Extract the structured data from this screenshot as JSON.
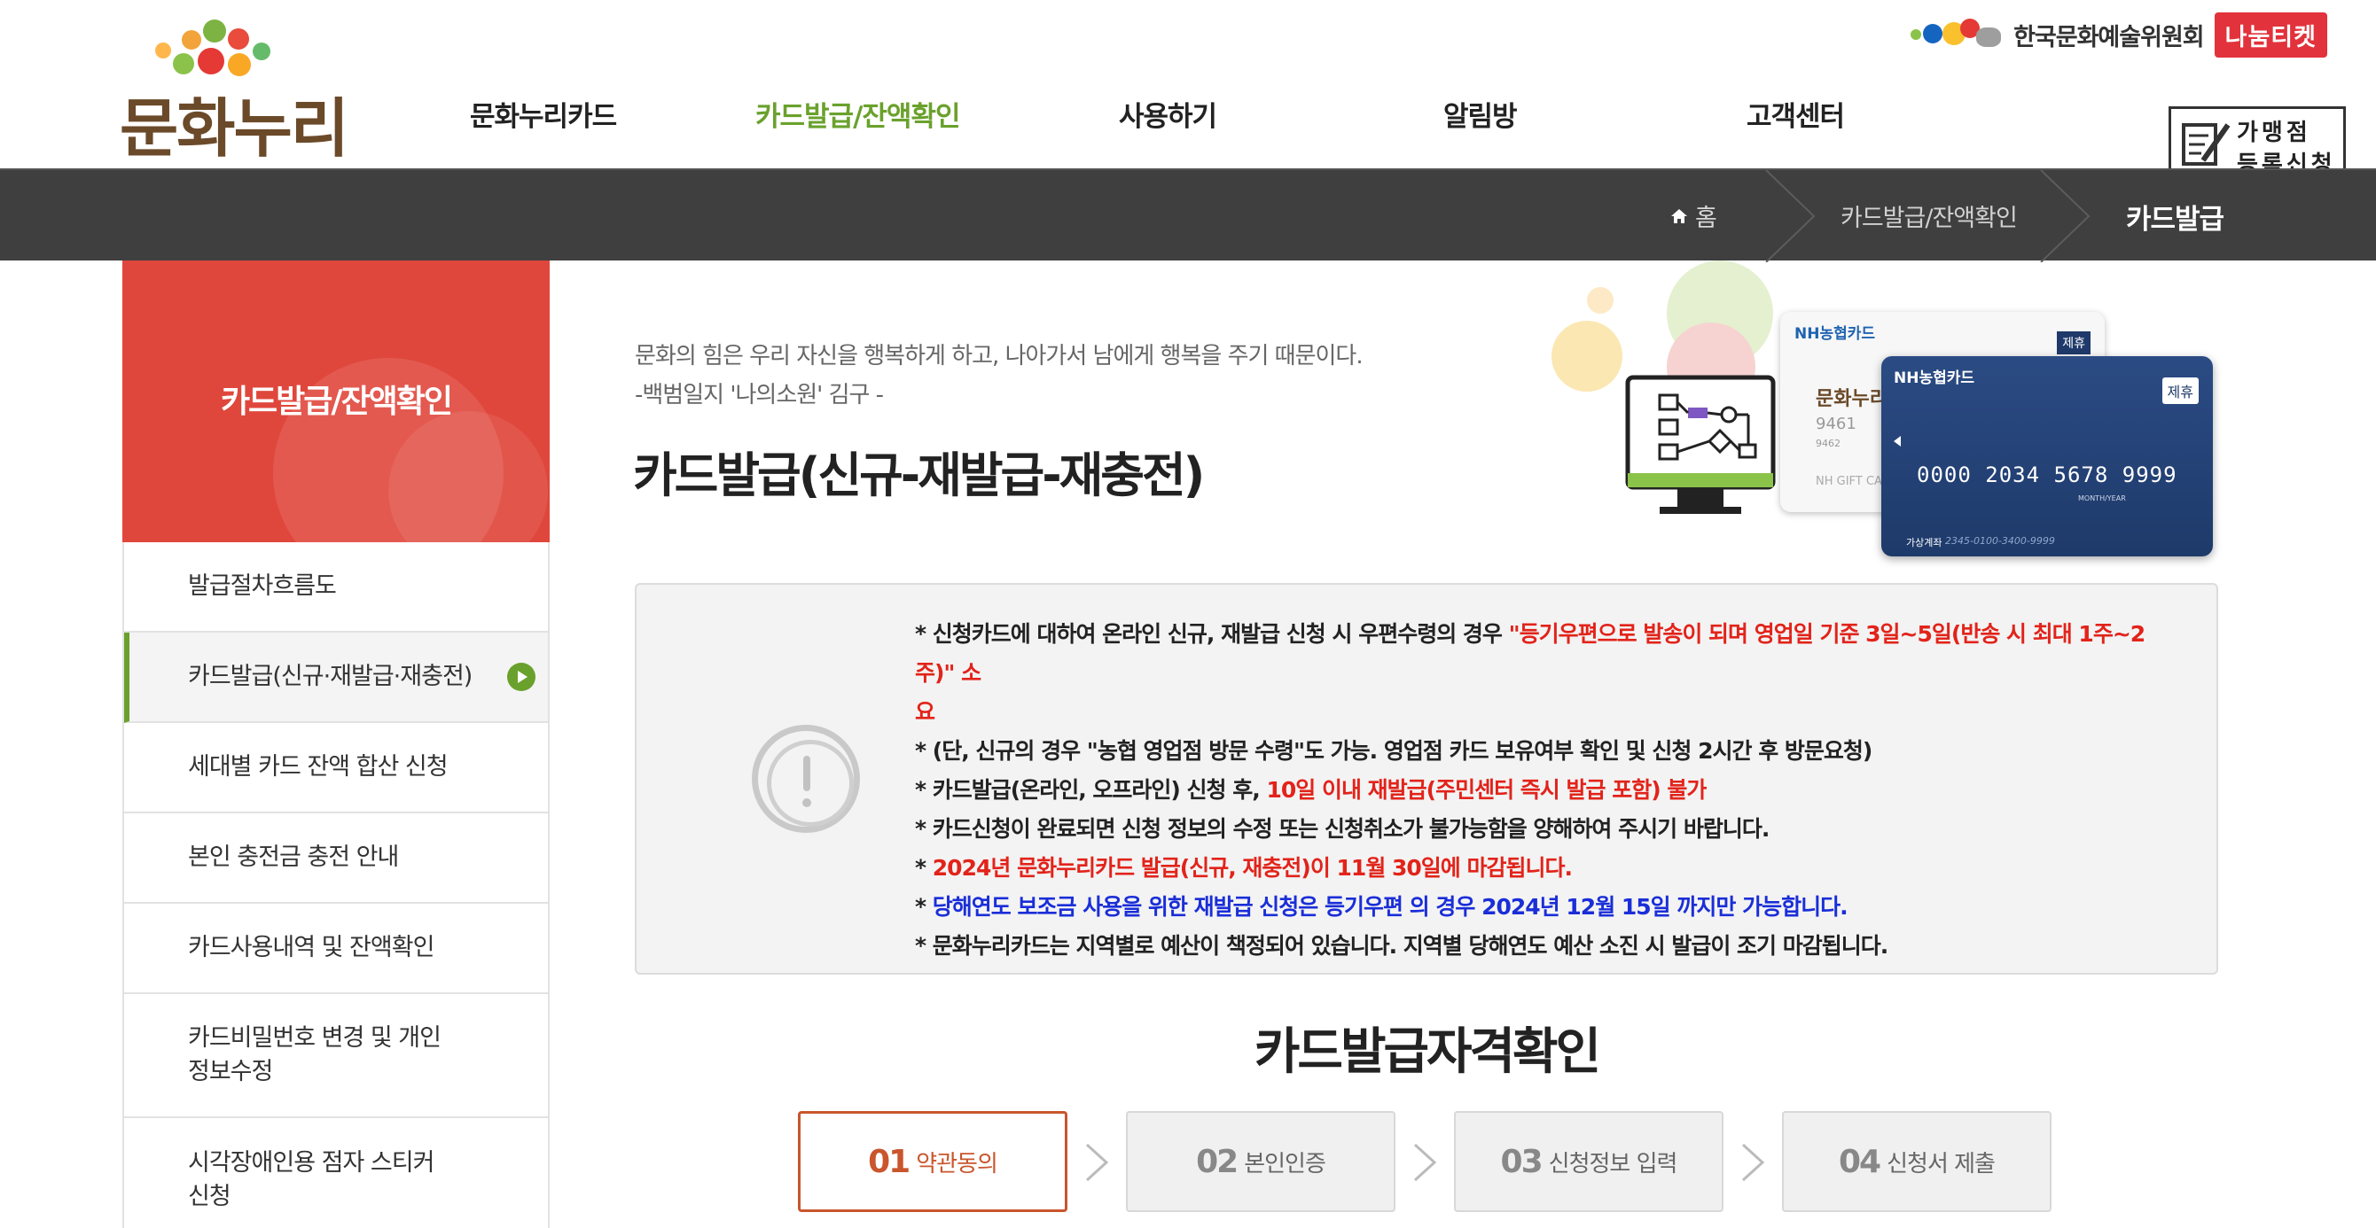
{
  "logo": {
    "text": "문화누리"
  },
  "topbar": {
    "org_name": "한국문화예술위원회",
    "nanum_label": "나눔티켓"
  },
  "gnb": [
    {
      "label": "문화누리카드",
      "active": false
    },
    {
      "label": "카드발급/잔액확인",
      "active": true
    },
    {
      "label": "사용하기",
      "active": false
    },
    {
      "label": "알림방",
      "active": false
    },
    {
      "label": "고객센터",
      "active": false
    }
  ],
  "franchise_button": {
    "line1": "가맹점",
    "line2": "등록신청"
  },
  "breadcrumb": {
    "home": "홈",
    "section": "카드발급/잔액확인",
    "current": "카드발급"
  },
  "sidebar": {
    "title": "카드발급/잔액확인",
    "items": [
      {
        "label": "발급절차흐름도",
        "active": false
      },
      {
        "label": "카드발급(신규·재발급·재충전)",
        "active": true
      },
      {
        "label": "세대별 카드 잔액 합산 신청",
        "active": false
      },
      {
        "label": "본인 충전금 충전 안내",
        "active": false
      },
      {
        "label": "카드사용내역 및 잔액확인",
        "active": false
      },
      {
        "label": "카드비밀번호 변경 및 개인정보수정",
        "active": false,
        "lines": [
          "카드비밀번호 변경 및 개인",
          "정보수정"
        ]
      },
      {
        "label": "시각장애인용 점자 스티커 신청",
        "active": false,
        "lines": [
          "시각장애인용 점자 스티커",
          "신청"
        ]
      }
    ]
  },
  "quote": {
    "line1": "문화의 힘은 우리 자신을 행복하게 하고, 나아가서 남에게 행복을 주기 때문이다.",
    "line2": "-백범일지 '나의소원' 김구 -"
  },
  "page_title": "카드발급(신규-재발급-재충전)",
  "cards": {
    "back_brand": "NH농협카드",
    "back_logo": "문화누리",
    "back_num": "9461",
    "back_small": "9462",
    "back_gift": "NH GIFT CA",
    "back_badge": "제휴",
    "front_brand": "NH농협카드",
    "front_badge": "제휴",
    "front_number": "0000 2034 5678 9999",
    "front_month": "MONTH/YEAR",
    "front_acct_label": "가상계좌",
    "front_acct": "2345-0100-3400-9999"
  },
  "notice": {
    "l1a": "* 신청카드에 대하여 온라인 신규, 재발급 신청 시 우편수령의 경우 ",
    "l1b": "\"등기우편으로 발송이 되며 영업일 기준 3일~5일(반송 시 최대 1주~2주)\" 소",
    "l1c": "요",
    "l2": "* (단, 신규의 경우 \"농협 영업점 방문 수령\"도 가능. 영업점 카드 보유여부 확인 및 신청 2시간 후 방문요청)",
    "l3a": "* 카드발급(온라인, 오프라인) 신청 후, ",
    "l3b": "10일 이내 재발급(주민센터 즉시 발급 포함) 불가",
    "l4": "* 카드신청이 완료되면 신청 정보의 수정 또는 신청취소가 불가능함을 양해하여 주시기 바랍니다.",
    "l5a": "* ",
    "l5b": "2024년 문화누리카드 발급(신규, 재충전)이 11월 30일에 마감됩니다.",
    "l6a": "* ",
    "l6b": "당해연도 보조금 사용을 위한 재발급 신청은 등기우편 의 경우 2024년 12월 15일 까지만 가능합니다.",
    "l7": "* 문화누리카드는 지역별로 예산이 책정되어 있습니다. 지역별 당해연도 예산 소진 시 발급이 조기 마감됩니다."
  },
  "section_title": "카드발급자격확인",
  "steps": [
    {
      "num": "01",
      "label": "약관동의",
      "active": true
    },
    {
      "num": "02",
      "label": "본인인증",
      "active": false
    },
    {
      "num": "03",
      "label": "신청정보 입력",
      "active": false
    },
    {
      "num": "04",
      "label": "신청서 제출",
      "active": false
    }
  ],
  "colors": {
    "accent_green": "#6aa12c",
    "sidebar_red": "#e0473c",
    "warn_red": "#e2231a",
    "info_blue": "#1a2ed8",
    "step_active": "#c9562c",
    "bar_dark": "#3f3f3f"
  }
}
